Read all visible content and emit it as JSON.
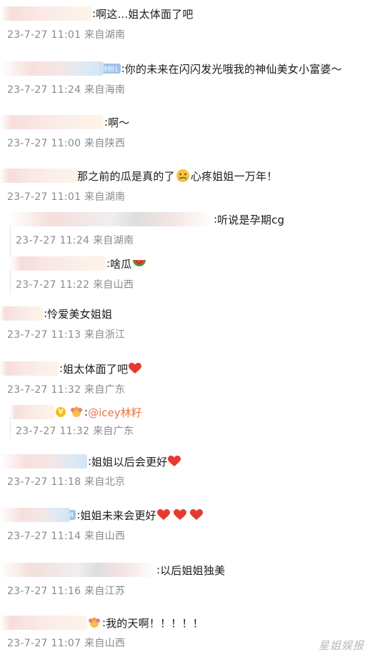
{
  "comments": [
    {
      "colon": ":",
      "text": "啊这...姐太体面了吧",
      "date": "23-7-27 11:01",
      "location": "来自湖南"
    },
    {
      "colon": ":",
      "badge": "铁粉1",
      "text": "你的未来在闪闪发光哦我的神仙美女小富婆～",
      "date": "23-7-27 11:24",
      "location": "来自海南"
    },
    {
      "colon": ":",
      "text": "啊～",
      "date": "23-7-27 11:00",
      "location": "来自陕西"
    },
    {
      "text_before": "那之前的瓜是真的了",
      "text_after": "心疼姐姐一万年！",
      "date": "23-7-27 11:01",
      "location": "来自湖南"
    },
    {
      "colon": ":",
      "text": "听说是孕期cg",
      "date": "23-7-27 11:24",
      "location": "来自湖南"
    },
    {
      "colon": ":",
      "text": "啥瓜",
      "date": "23-7-27 11:22",
      "location": "来自山西"
    },
    {
      "colon": ":",
      "text": "怜爱美女姐姐",
      "date": "23-7-27 11:13",
      "location": "来自浙江"
    },
    {
      "colon": ":",
      "text": "姐太体面了吧",
      "date": "23-7-27 11:32",
      "location": "来自广东"
    },
    {
      "colon": ":",
      "mention": "@icey林籽",
      "vip": "V",
      "date": "23-7-27 11:32",
      "location": "来自广东"
    },
    {
      "colon": ":",
      "text": "姐姐以后会更好",
      "date": "23-7-27 11:18",
      "location": "来自北京"
    },
    {
      "colon": ":",
      "text": "姐姐未来会更好",
      "badge": "4",
      "date": "23-7-27 11:14",
      "location": "来自山西"
    },
    {
      "colon": ":",
      "text": "以后姐姐独美",
      "date": "23-7-27 11:16",
      "location": "来自江苏"
    },
    {
      "colon": ":",
      "text": "我的天啊！！！！！",
      "date": "23-7-27 11:07",
      "location": "来自山西"
    }
  ],
  "watermark": "星姐娱报"
}
